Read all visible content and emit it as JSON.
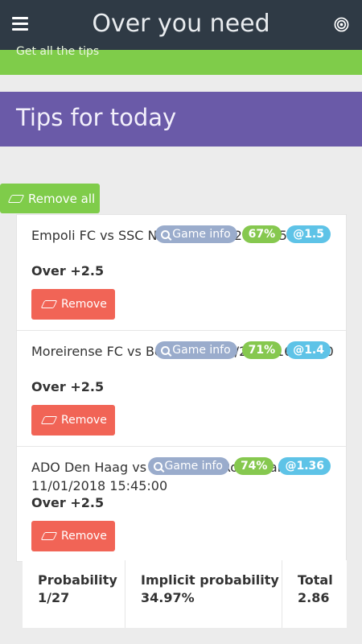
{
  "header": {
    "title": "Over you need",
    "menu_icon": "hamburger-menu-icon",
    "right_icon": "target-icon"
  },
  "banner": {
    "text": "Get all the tips"
  },
  "section": {
    "title": "Tips for today"
  },
  "remove_all": {
    "label": "Remove all",
    "icon": "eraser-icon"
  },
  "tips": [
    {
      "teams": "Empoli FC vs SSC Napoli 11/02/2018 15:30:00",
      "market": "Over +2.5",
      "info_label": "Game info",
      "percent": "67%",
      "odds": "@1.5",
      "remove_label": "Remove"
    },
    {
      "teams": "Moreirense FC vs Benfica 11/02/2018 16:30:00",
      "market": "Over +2.5",
      "info_label": "Game info",
      "percent": "71%",
      "odds": "@1.4",
      "remove_label": "Remove"
    },
    {
      "teams": "ADO Den Haag vs Feyenoord Rotterdam 11/01/2018 15:45:00",
      "market": "Over +2.5",
      "info_label": "Game info",
      "percent": "74%",
      "odds": "@1.36",
      "remove_label": "Remove"
    }
  ],
  "summary": {
    "probability_label": "Probability",
    "probability_value": "1/27",
    "implicit_label": "Implicit probability",
    "implicit_value": "34.97%",
    "total_label": "Total",
    "total_value": "2.86"
  },
  "colors": {
    "topbar": "#2f3a45",
    "green": "#7fcc4a",
    "purple": "#6a5aa8",
    "remove": "#f16456",
    "info": "#9aaccc",
    "odds": "#5ec3e7"
  }
}
